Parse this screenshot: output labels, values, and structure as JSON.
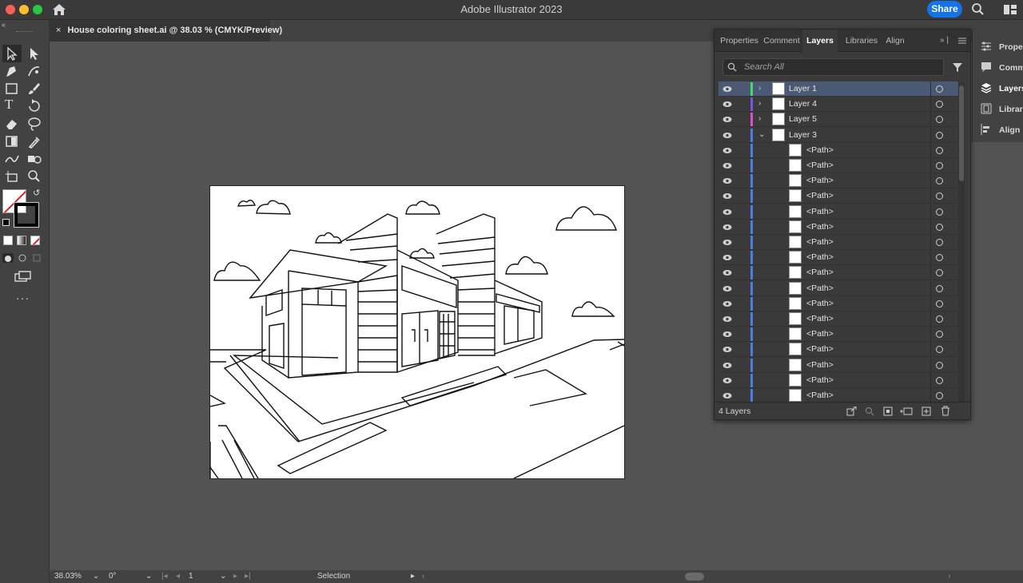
{
  "window": {
    "title": "Adobe Illustrator 2023",
    "share_label": "Share"
  },
  "document": {
    "tab_title": "House coloring sheet.ai @ 38.03 % (CMYK/Preview)",
    "close_glyph": "×"
  },
  "status": {
    "zoom": "38.03%",
    "rotation": "0°",
    "artboard_number": "1",
    "tool_label": "Selection"
  },
  "panel": {
    "tabs": [
      "Properties",
      "Comment",
      "Layers",
      "Libraries",
      "Align"
    ],
    "active_tab": "Layers",
    "search_placeholder": "Search All",
    "footer_count": "4 Layers",
    "layers": [
      {
        "name": "Layer 1",
        "color": "#4fd36b",
        "expanded": false,
        "selected": true
      },
      {
        "name": "Layer 4",
        "color": "#7a55e0",
        "expanded": false,
        "selected": false
      },
      {
        "name": "Layer 5",
        "color": "#e04fc9",
        "expanded": false,
        "selected": false
      },
      {
        "name": "Layer 3",
        "color": "#4f7be6",
        "expanded": true,
        "selected": false
      }
    ],
    "sublayers": [
      "<Path>",
      "<Path>",
      "<Path>",
      "<Path>",
      "<Path>",
      "<Path>",
      "<Path>",
      "<Path>",
      "<Path>",
      "<Path>",
      "<Path>",
      "<Path>",
      "<Path>",
      "<Path>",
      "<Path>",
      "<Path>",
      "<Path>"
    ]
  },
  "dock": {
    "items": [
      {
        "label": "Properties",
        "icon": "sliders-icon"
      },
      {
        "label": "Comments",
        "icon": "comment-icon"
      },
      {
        "label": "Layers",
        "icon": "layers-icon"
      },
      {
        "label": "Libraries",
        "icon": "libraries-icon"
      },
      {
        "label": "Align",
        "icon": "align-icon"
      }
    ]
  },
  "colors": {
    "accent": "#1473e6",
    "selection_row": "#4a5a75",
    "sublayer_color": "#4f7be6"
  }
}
